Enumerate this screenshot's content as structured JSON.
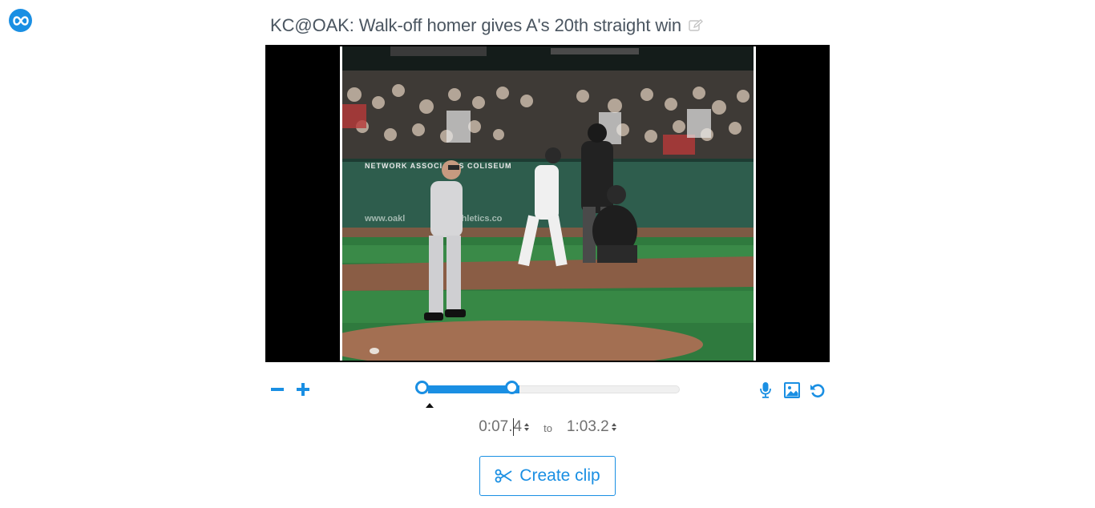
{
  "app": {
    "logo_icon": "infinity-loop-icon",
    "accent_color": "#1a8fe3"
  },
  "header": {
    "title": "KC@OAK: Walk-off homer gives A's 20th straight win",
    "edit_icon": "pencil-edit-icon"
  },
  "player": {
    "background": "#000000",
    "scoreboard_text": "NETWORK ASSOCIATES COLISEUM",
    "wall_text": "www.oakl",
    "wall_text_2": "thletics.co"
  },
  "controls": {
    "zoom_out_icon": "minus-icon",
    "zoom_in_icon": "plus-icon",
    "timeline": {
      "range_start_fraction": 0.031,
      "range_end_fraction": 0.382
    },
    "mic_icon": "microphone-icon",
    "image_icon": "image-icon",
    "reset_icon": "undo-icon"
  },
  "clip_range": {
    "start": "0:07.4",
    "start_before_caret": "0:07.",
    "start_after_caret": "4",
    "to_label": "to",
    "end": "1:03.2"
  },
  "create_clip": {
    "label": "Create clip",
    "icon": "scissors-icon"
  }
}
